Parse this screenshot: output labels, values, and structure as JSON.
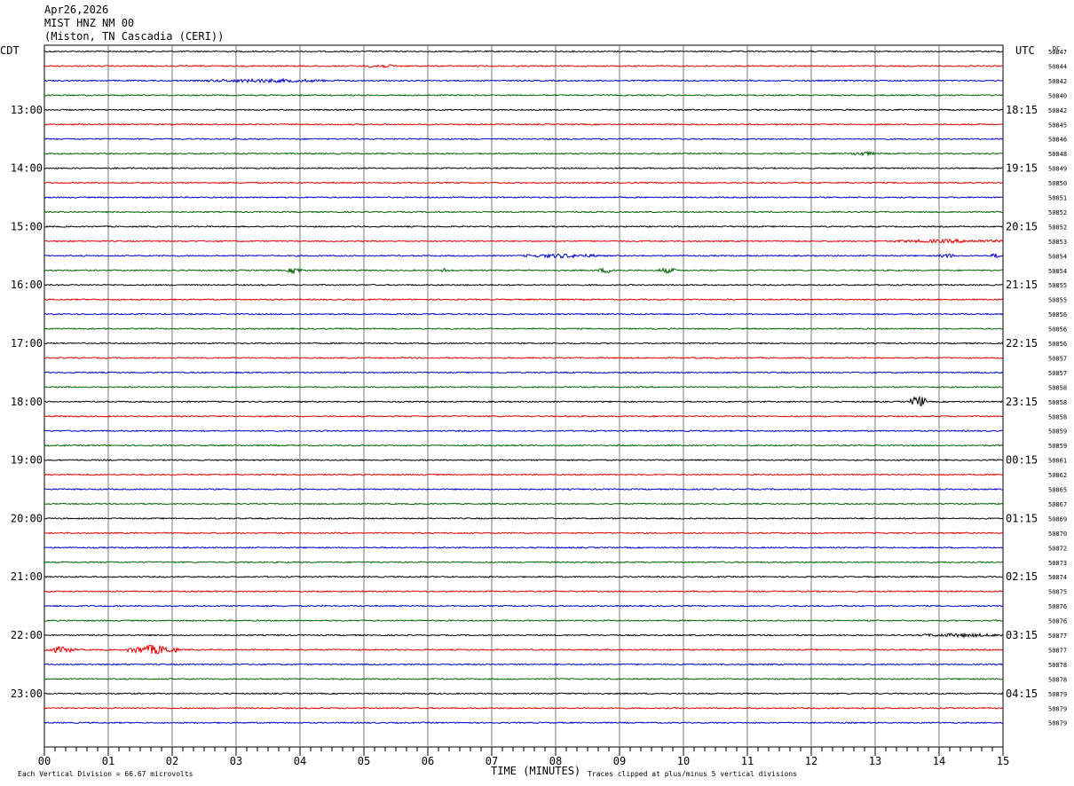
{
  "header": {
    "date": "Apr26,2026",
    "station": "MIST HNZ NM 00",
    "location": "(Miston, TN Cascadia (CERI))"
  },
  "chart_data": {
    "type": "line",
    "title": "MIST HNZ NM 00",
    "left_timezone": "CDT",
    "right_timezone": "UTC",
    "dc_label": "DC",
    "xlabel": "TIME (MINUTES)",
    "xlim": [
      0,
      15
    ],
    "x_ticks": [
      "00",
      "01",
      "02",
      "03",
      "04",
      "05",
      "06",
      "07",
      "08",
      "09",
      "10",
      "11",
      "12",
      "13",
      "14",
      "15"
    ],
    "left_hour_labels": [
      "13:00",
      "14:00",
      "15:00",
      "16:00",
      "17:00",
      "18:00",
      "19:00",
      "20:00",
      "21:00",
      "22:00",
      "23:00"
    ],
    "right_hour_labels": [
      "18:15",
      "19:15",
      "20:15",
      "21:15",
      "22:15",
      "23:15",
      "00:15",
      "01:15",
      "02:15",
      "03:15",
      "04:15"
    ],
    "trace_colors": [
      "#000000",
      "#e00000",
      "#0000c8",
      "#006400"
    ],
    "dc_offsets": [
      "50847",
      "50844",
      "50842",
      "50840",
      "50842",
      "50845",
      "50846",
      "50848",
      "50849",
      "50850",
      "50851",
      "50852",
      "50852",
      "50853",
      "50854",
      "50854",
      "50855",
      "50855",
      "50856",
      "50856",
      "50856",
      "50857",
      "50857",
      "50858",
      "50858",
      "50858",
      "50859",
      "50859",
      "50861",
      "50862",
      "50865",
      "50867",
      "50869",
      "50870",
      "50872",
      "50873",
      "50874",
      "50875",
      "50876",
      "50876",
      "50877",
      "50877",
      "50878",
      "50878",
      "50879",
      "50879",
      "50879"
    ],
    "events": [
      {
        "trace": 41,
        "start_min": 0.0,
        "end_min": 0.5,
        "amplitude": 3
      },
      {
        "trace": 41,
        "start_min": 1.3,
        "end_min": 2.1,
        "amplitude": 5
      },
      {
        "trace": 24,
        "start_min": 13.55,
        "end_min": 13.8,
        "amplitude": 7
      },
      {
        "trace": 15,
        "start_min": 3.8,
        "end_min": 4.05,
        "amplitude": 3
      },
      {
        "trace": 15,
        "start_min": 6.2,
        "end_min": 6.35,
        "amplitude": 2
      },
      {
        "trace": 15,
        "start_min": 8.65,
        "end_min": 8.95,
        "amplitude": 2.5
      },
      {
        "trace": 15,
        "start_min": 9.6,
        "end_min": 9.9,
        "amplitude": 2.5
      },
      {
        "trace": 2,
        "start_min": 2.5,
        "end_min": 4.4,
        "amplitude": 1.5
      },
      {
        "trace": 1,
        "start_min": 5.0,
        "end_min": 5.5,
        "amplitude": 1.5
      },
      {
        "trace": 7,
        "start_min": 12.6,
        "end_min": 13.0,
        "amplitude": 2
      },
      {
        "trace": 14,
        "start_min": 7.5,
        "end_min": 8.7,
        "amplitude": 1.8
      },
      {
        "trace": 14,
        "start_min": 14.0,
        "end_min": 14.25,
        "amplitude": 2
      },
      {
        "trace": 14,
        "start_min": 14.8,
        "end_min": 15.0,
        "amplitude": 2
      },
      {
        "trace": 13,
        "start_min": 13.3,
        "end_min": 15.0,
        "amplitude": 1.5
      },
      {
        "trace": 40,
        "start_min": 13.7,
        "end_min": 15.0,
        "amplitude": 1.5
      }
    ]
  },
  "footer": {
    "vertical_division": "Each Vertical Division =   66.67 microvolts",
    "clip_note": "Traces clipped at plus/minus 5 vertical divisions"
  }
}
